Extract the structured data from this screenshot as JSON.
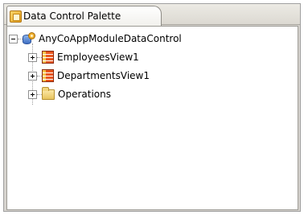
{
  "palette": {
    "tab_title": "Data Control Palette"
  },
  "tree": {
    "root": {
      "label": "AnyCoAppModuleDataControl",
      "expanded": true,
      "icon": "data-control-icon"
    },
    "children": [
      {
        "label": "EmployeesView1",
        "expanded": false,
        "icon": "view-object-icon"
      },
      {
        "label": "DepartmentsView1",
        "expanded": false,
        "icon": "view-object-icon"
      },
      {
        "label": "Operations",
        "expanded": false,
        "icon": "folder-icon"
      }
    ]
  },
  "colors": {
    "panel_bg": "#d6d3ce",
    "tree_bg": "#ffffff",
    "view_icon": "#e9571f",
    "folder_icon": "#e8c45e"
  }
}
